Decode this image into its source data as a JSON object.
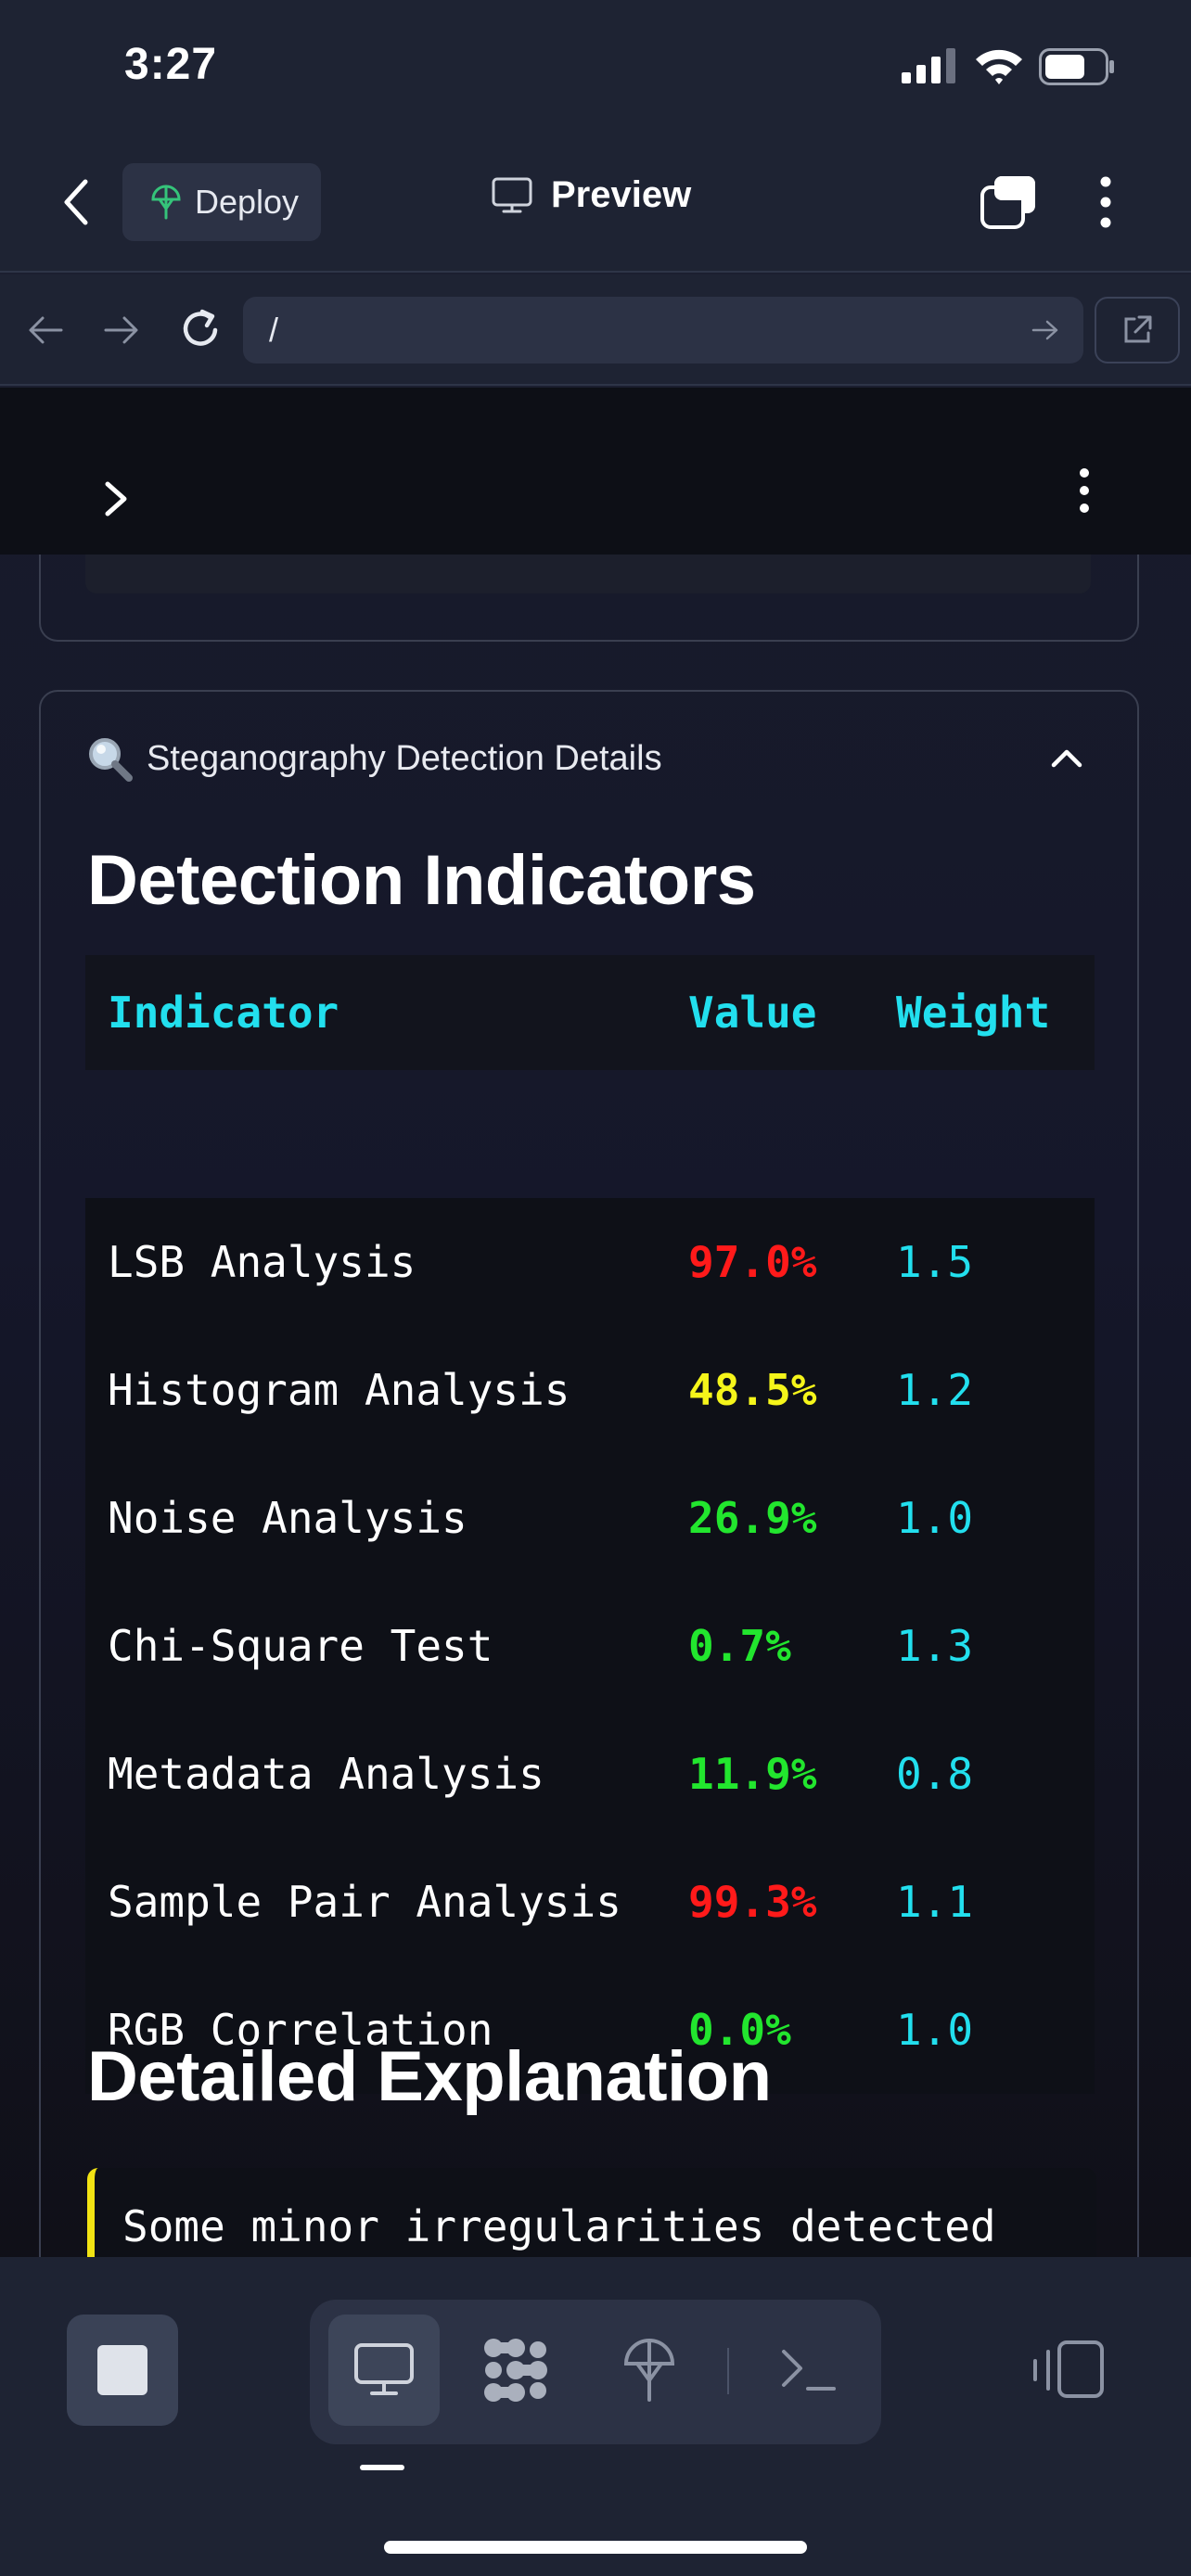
{
  "status_bar": {
    "time": "3:27"
  },
  "nav": {
    "deploy_label": "Deploy",
    "title": "Preview"
  },
  "browser": {
    "url": "/"
  },
  "expander": {
    "title": "Steganography Detection Details",
    "heading_indicators": "Detection Indicators",
    "heading_explanation": "Detailed Explanation"
  },
  "table": {
    "headers": [
      "Indicator",
      "Value",
      "Weight"
    ],
    "rows": [
      {
        "indicator": "LSB Analysis",
        "value": "97.0%",
        "weight": "1.5",
        "color": "#ff1a1a"
      },
      {
        "indicator": "Histogram Analysis",
        "value": "48.5%",
        "weight": "1.2",
        "color": "#f5f51a"
      },
      {
        "indicator": "Noise Analysis",
        "value": "26.9%",
        "weight": "1.0",
        "color": "#22e62e"
      },
      {
        "indicator": "Chi-Square Test",
        "value": "0.7%",
        "weight": "1.3",
        "color": "#22e62e"
      },
      {
        "indicator": "Metadata Analysis",
        "value": "11.9%",
        "weight": "0.8",
        "color": "#22e62e"
      },
      {
        "indicator": "Sample Pair Analysis",
        "value": "99.3%",
        "weight": "1.1",
        "color": "#ff1a1a"
      },
      {
        "indicator": "RGB Correlation",
        "value": "0.0%",
        "weight": "1.0",
        "color": "#22e62e"
      }
    ]
  },
  "explanation": {
    "text": "Some minor irregularities detected"
  },
  "colors": {
    "accent_cyan": "#22dfee",
    "high": "#ff1a1a",
    "medium": "#f5f51a",
    "low": "#22e62e",
    "callout": "#f2e313"
  },
  "icons": {
    "signal": "cellular-signal-icon",
    "wifi": "wifi-icon",
    "battery": "battery-icon",
    "deploy": "deploy-umbrella-icon",
    "preview": "monitor-icon",
    "tabs": "tabs-icon",
    "search": "magnifier-emoji-icon"
  }
}
